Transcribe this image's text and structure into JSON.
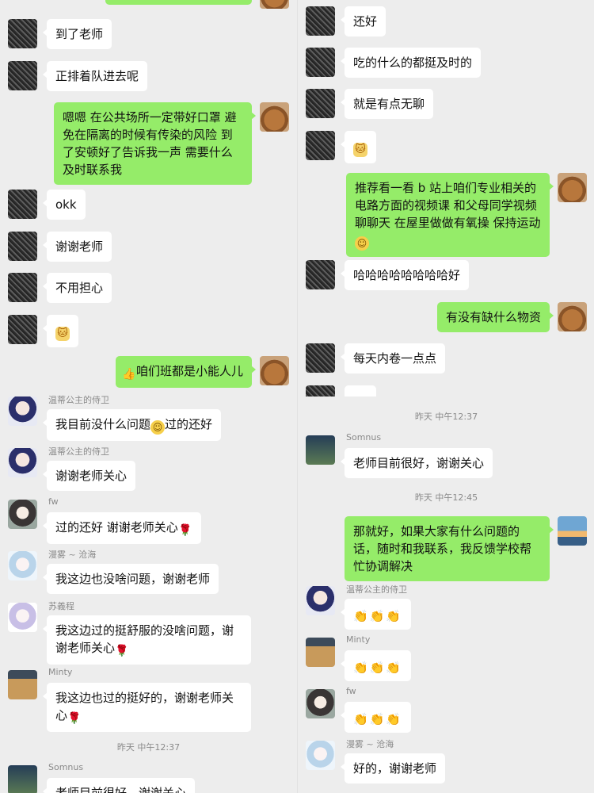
{
  "left": {
    "messages": [
      {
        "dir": "in",
        "text": "到了老师"
      },
      {
        "dir": "in",
        "text": "正排着队进去呢"
      },
      {
        "dir": "out",
        "text": "嗯嗯 在公共场所一定带好口罩 避免在隔离的时候有传染的风险 到了安顿好了告诉我一声 需要什么及时联系我"
      },
      {
        "dir": "in",
        "text": "okk"
      },
      {
        "dir": "in",
        "text": "谢谢老师"
      },
      {
        "dir": "in",
        "text": "不用担心"
      },
      {
        "dir": "in",
        "emoji": "cat-emoji"
      },
      {
        "dir": "out",
        "text": "咱们班都是小能人儿",
        "emoji": "thumbs-up-emoji"
      },
      {
        "dir": "in",
        "sender": "温蒂公主的侍卫",
        "text": "我目前没什么问题",
        "text_after": "过的还好",
        "emoji": "smile-emoji"
      },
      {
        "dir": "in",
        "sender": "温蒂公主的侍卫",
        "text": "谢谢老师关心"
      },
      {
        "dir": "in",
        "sender": "fw",
        "text": "过的还好 谢谢老师关心",
        "emoji": "rose-emoji"
      },
      {
        "dir": "in",
        "sender": "漫雾 ~ 沧海",
        "text": "我这边也没啥问题，谢谢老师"
      },
      {
        "dir": "in",
        "sender": "苏義程",
        "text": "我这边过的挺舒服的没啥问题，谢谢老师关心",
        "emoji": "rose-emoji"
      },
      {
        "dir": "in",
        "sender": "Minty",
        "text": "我这边也过的挺好的，谢谢老师关心",
        "emoji": "rose-emoji"
      },
      {
        "dir": "in",
        "sender": "Somnus",
        "text": "老师目前很好，谢谢关心"
      }
    ],
    "timestamp": "昨天 中午12:37"
  },
  "right": {
    "messages": [
      {
        "dir": "in",
        "text": "还好"
      },
      {
        "dir": "in",
        "text": "吃的什么的都挺及时的"
      },
      {
        "dir": "in",
        "text": "就是有点无聊"
      },
      {
        "dir": "in",
        "emoji": "cat-emoji"
      },
      {
        "dir": "out",
        "text": "推荐看一看 b 站上咱们专业相关的电路方面的视频课 和父母同学视频聊聊天 在屋里做做有氧操 保持运动",
        "emoji": "smile-emoji"
      },
      {
        "dir": "in",
        "text": "哈哈哈哈哈哈哈哈好"
      },
      {
        "dir": "out",
        "text": "有没有缺什么物资"
      },
      {
        "dir": "in",
        "text": "每天内卷一点点"
      },
      {
        "dir": "in",
        "sender": "Somnus",
        "text": "老师目前很好，谢谢关心"
      },
      {
        "dir": "out",
        "text": "那就好，如果大家有什么问题的话，随时和我联系，我反馈学校帮忙协调解决"
      },
      {
        "dir": "in",
        "sender": "温蒂公主的侍卫",
        "emoji": "clap-emoji"
      },
      {
        "dir": "in",
        "sender": "Minty",
        "emoji": "clap-emoji"
      },
      {
        "dir": "in",
        "sender": "fw",
        "emoji": "clap-emoji"
      },
      {
        "dir": "in",
        "sender": "漫雾 ~ 沧海",
        "text": "好的，谢谢老师"
      }
    ],
    "timestamps": [
      "昨天 中午12:37",
      "昨天 中午12:45"
    ]
  },
  "glyphs": {
    "smile": "☺",
    "rose": "🌹",
    "thumb": "👍",
    "cat": "🐱",
    "clap": "👏👏👏"
  }
}
